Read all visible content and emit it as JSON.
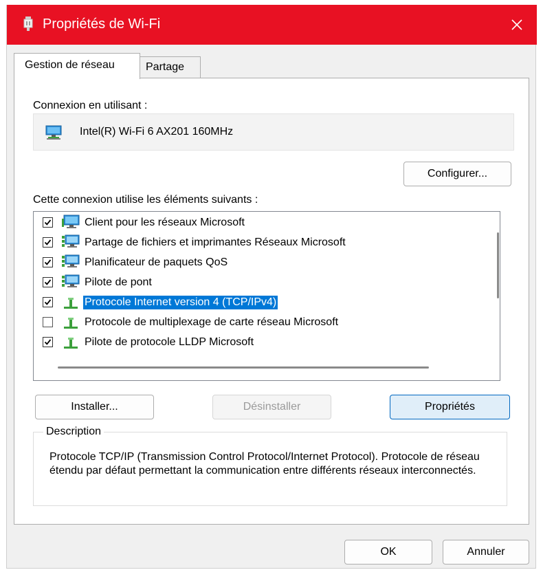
{
  "window": {
    "title": "Propriétés de Wi-Fi",
    "accent_color": "#e81123"
  },
  "tabs": [
    {
      "label": "Gestion de réseau",
      "active": true
    },
    {
      "label": "Partage",
      "active": false
    }
  ],
  "connection": {
    "label": "Connexion en utilisant :",
    "adapter_name": "Intel(R) Wi-Fi 6 AX201 160MHz",
    "adapter_icon": "network-adapter-icon",
    "configure_label": "Configurer..."
  },
  "components": {
    "label": "Cette connexion utilise les éléments suivants :",
    "items": [
      {
        "label": "Client pour les réseaux Microsoft",
        "checked": true,
        "icon": "network-client-icon",
        "selected": false
      },
      {
        "label": "Partage de fichiers et imprimantes Réseaux Microsoft",
        "checked": true,
        "icon": "network-service-icon",
        "selected": false
      },
      {
        "label": "Planificateur de paquets QoS",
        "checked": true,
        "icon": "network-service-icon",
        "selected": false
      },
      {
        "label": "Pilote de pont",
        "checked": true,
        "icon": "network-service-icon",
        "selected": false
      },
      {
        "label": "Protocole Internet version 4 (TCP/IPv4)",
        "checked": true,
        "icon": "protocol-icon",
        "selected": true
      },
      {
        "label": "Protocole de multiplexage de carte réseau Microsoft",
        "checked": false,
        "icon": "protocol-icon",
        "selected": false
      },
      {
        "label": "Pilote de protocole LLDP Microsoft",
        "checked": true,
        "icon": "protocol-icon",
        "selected": false
      }
    ]
  },
  "actions": {
    "install": "Installer...",
    "uninstall": "Désinstaller",
    "properties": "Propriétés"
  },
  "description": {
    "legend": "Description",
    "text": "Protocole TCP/IP (Transmission Control Protocol/Internet Protocol). Protocole de réseau étendu par défaut permettant la communication entre différents réseaux interconnectés."
  },
  "footer": {
    "ok": "OK",
    "cancel": "Annuler"
  }
}
